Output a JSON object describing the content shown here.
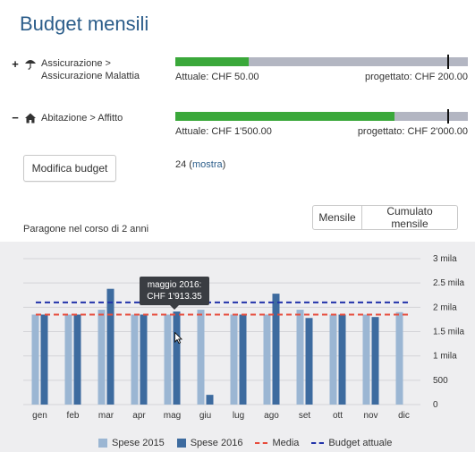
{
  "page": {
    "title": "Budget mensili"
  },
  "rows": [
    {
      "toggle": "+",
      "icon": "umbrella-icon",
      "label": "Assicurazione > Assicurazione Malattia",
      "actual": "Attuale: CHF 50.00",
      "projected": "progettato: CHF 200.00",
      "progress": 0.25
    },
    {
      "toggle": "−",
      "icon": "home-icon",
      "label": "Abitazione > Affitto",
      "actual": "Attuale: CHF 1'500.00",
      "projected": "progettato: CHF 2'000.00",
      "progress": 0.75
    }
  ],
  "edit_button": "Modifica budget",
  "count": {
    "number": "24",
    "link": "mostra"
  },
  "compare_label": "Paragone nel corso di 2 anni",
  "view_toggle": {
    "monthly": "Mensile",
    "cumulative": "Cumulato mensile"
  },
  "tooltip": {
    "line1": "maggio 2016:",
    "line2": "CHF 1'913.35"
  },
  "colors": {
    "series_2015": "#9bb6d3",
    "series_2016": "#3d6b9f",
    "average": "#e74c3c",
    "budget": "#2233aa",
    "progress": "#3aa83a",
    "track": "#b3b6c2"
  },
  "chart_data": {
    "type": "bar",
    "categories": [
      "gen",
      "feb",
      "mar",
      "apr",
      "mag",
      "giu",
      "lug",
      "ago",
      "set",
      "ott",
      "nov",
      "dic"
    ],
    "series": [
      {
        "name": "Spese 2015",
        "values": [
          1850,
          1850,
          1950,
          1850,
          1850,
          1950,
          1850,
          1850,
          1950,
          1850,
          1850,
          1900
        ]
      },
      {
        "name": "Spese 2016",
        "values": [
          1850,
          1850,
          2380,
          1850,
          1913.35,
          200,
          1850,
          2280,
          1780,
          1850,
          1800,
          null
        ]
      }
    ],
    "lines": [
      {
        "name": "Media",
        "value": 1850,
        "style": "dashed"
      },
      {
        "name": "Budget attuale",
        "value": 2100,
        "style": "dashed"
      }
    ],
    "ylim": [
      0,
      3000
    ],
    "yticks": [
      0,
      500,
      1000,
      1500,
      2000,
      2500,
      3000
    ],
    "ytick_labels": [
      "0",
      "500",
      "1 mila",
      "1.5 mila",
      "2 mila",
      "2.5 mila",
      "3 mila"
    ],
    "legend_position": "bottom",
    "grid": true
  }
}
